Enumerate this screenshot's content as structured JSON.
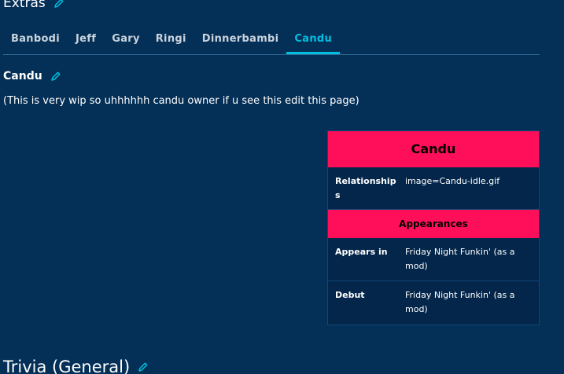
{
  "extras_section": {
    "title": "Extras",
    "edit_icon": "pencil-icon"
  },
  "tabs": [
    {
      "label": "Banbodi",
      "active": false
    },
    {
      "label": "Jeff",
      "active": false
    },
    {
      "label": "Gary",
      "active": false
    },
    {
      "label": "Ringi",
      "active": false
    },
    {
      "label": "Dinnerbambi",
      "active": false
    },
    {
      "label": "Candu",
      "active": true
    }
  ],
  "candu_section": {
    "title": "Candu",
    "edit_icon": "pencil-icon",
    "intro": "(This is very wip so uhhhhhh candu owner if u see this edit this page)"
  },
  "infobox": {
    "title": "Candu",
    "relationships_label": "Relationships",
    "relationships_value": "image=Candu-idle.gif",
    "appearances_header": "Appearances",
    "appears_in_label": "Appears in",
    "appears_in_value": "Friday Night Funkin' (as a mod)",
    "debut_label": "Debut",
    "debut_value": "Friday Night Funkin' (as a mod)"
  },
  "trivia_section": {
    "title": "Trivia (General)",
    "edit_icon": "pencil-icon"
  },
  "colors": {
    "background": "#042f56",
    "accent": "#00bfe0",
    "infobox_header": "#ff0e59"
  }
}
